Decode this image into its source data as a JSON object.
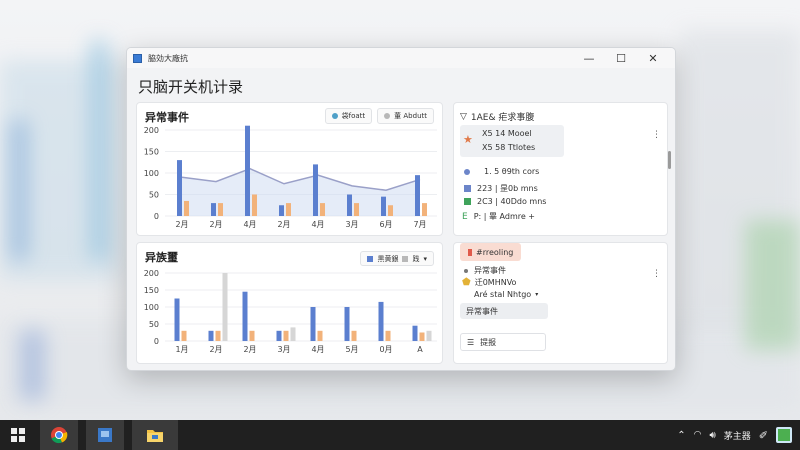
{
  "window": {
    "title": "脇効大廠抗",
    "page_title": "只脑开关机计录"
  },
  "top_chart": {
    "title": "异常事件",
    "legend": [
      {
        "label": "袋foatt",
        "color": "#4fa0c8"
      },
      {
        "label": "董 Abdutt",
        "color": "#b8b8b8"
      }
    ],
    "chart_data": {
      "type": "bar",
      "categories": [
        "2月",
        "2月",
        "4月",
        "2月",
        "4月",
        "3月",
        "6月",
        "7月"
      ],
      "yticks": [
        0,
        50,
        100,
        150,
        200
      ],
      "ylim": [
        0,
        200
      ],
      "series": [
        {
          "values": [
            130,
            30,
            210,
            25,
            120,
            50,
            45,
            95
          ],
          "color": "#5b7fcf"
        },
        {
          "values": [
            35,
            30,
            50,
            30,
            30,
            30,
            25,
            30
          ],
          "color": "#f2b27a"
        },
        {
          "values": [
            90,
            80,
            110,
            75,
            95,
            70,
            60,
            85
          ],
          "color": "#9aa0c8"
        }
      ]
    }
  },
  "bottom_chart": {
    "title": "异族璽",
    "select_label": "黒黄銀",
    "select_value": "践",
    "chart_data": {
      "type": "bar",
      "categories": [
        "1月",
        "2月",
        "2月",
        "3月",
        "4月",
        "5月",
        "0月",
        "A"
      ],
      "yticks": [
        0,
        50,
        100,
        150,
        200
      ],
      "ylim": [
        0,
        200
      ],
      "series": [
        {
          "values": [
            125,
            30,
            145,
            30,
            100,
            100,
            115,
            45
          ],
          "color": "#5b7fcf"
        },
        {
          "values": [
            30,
            30,
            30,
            30,
            30,
            30,
            30,
            25
          ],
          "color": "#f2b27a"
        },
        {
          "values": [
            0,
            200,
            0,
            40,
            0,
            0,
            0,
            30
          ],
          "color": "#d6d6d6"
        }
      ]
    }
  },
  "side_top": {
    "title": "1AE& 疟求事腹",
    "item1_line1": "X5 14 Mooel",
    "item1_line2": "X5 58 Ttlotes",
    "item2": "1. 5  θ9th cors",
    "item3_a": "223 | 昰0b mns",
    "item3_b": "2C3 | 40Ddo mns",
    "item3_c": "P: | 畢 Admre +"
  },
  "side_bottom": {
    "badge": "#rreoling",
    "row1": "异常事件",
    "row2_line1": "迁0MHNVo",
    "row2_line2": "Aré stal Nhtgo",
    "row3": "异常事件",
    "row4": "提报"
  },
  "taskbar": {
    "clock": "茅主器",
    "apps": [
      "start",
      "chrome",
      "app",
      "explorer"
    ]
  }
}
